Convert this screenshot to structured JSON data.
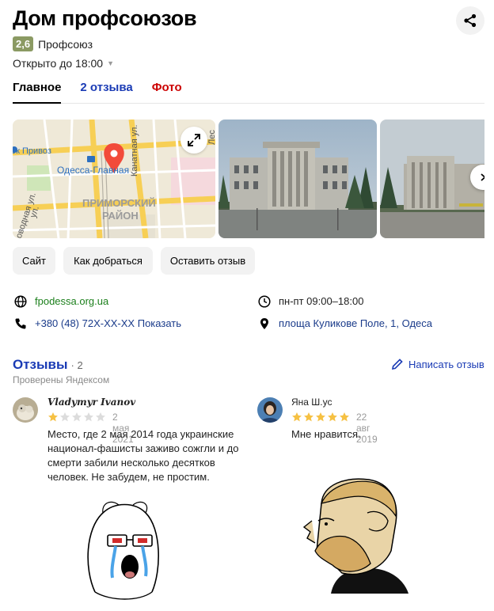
{
  "place": {
    "name": "Дом профсоюзов",
    "rating": "2,6",
    "category": "Профсоюз",
    "hours_status": "Открыто до 18:00"
  },
  "tabs": [
    {
      "label": "Главное"
    },
    {
      "label": "2 отзыва"
    },
    {
      "label": "Фото"
    }
  ],
  "map": {
    "labels": {
      "privoz": "ок Привоз",
      "station": "Одесса-Главная",
      "kanatnaya": "Канатная ул.",
      "district_line1": "ПРИМОРСКИЙ",
      "district_line2": "РАЙОН",
      "ul1": "ул.",
      "ul2": "оводная ул.",
      "les": "Лес"
    }
  },
  "actions": {
    "site": "Сайт",
    "route": "Как добраться",
    "leave_review": "Оставить отзыв"
  },
  "info": {
    "website": "fpodessa.org.ua",
    "phone": "+380 (48) 72X-XX-XX",
    "phone_show": "Показать",
    "schedule": "пн-пт 09:00–18:00",
    "address": "площа Куликове Поле, 1, Одеса"
  },
  "reviews": {
    "title": "Отзывы",
    "count_text": "· 2",
    "verified": "Проверены Яндексом",
    "write_label": "Написать отзыв",
    "items": [
      {
        "author": "Vladymyr Ivanov",
        "rating": 1,
        "date": "2 мая 2021",
        "text_lines": [
          "Место, где 2 мая 2014 года украинские",
          "национал-фашисты заживо сожгли и до",
          "смерти забили несколько десятков",
          "человек. Не забудем, не простим."
        ]
      },
      {
        "author": "Яна Ш.ус",
        "rating": 5,
        "date": "22 авг 2019",
        "text_lines": [
          "Мне нравится."
        ]
      }
    ]
  },
  "colors": {
    "rating_badge": "#8b9a63",
    "link_blue": "#1a3bb5",
    "photo_tab_red": "#cc0000",
    "website_green": "#1b7f1b",
    "star_gold": "#f6c143",
    "star_empty": "#dcdcdc",
    "map_pin": "#f24b3a"
  }
}
